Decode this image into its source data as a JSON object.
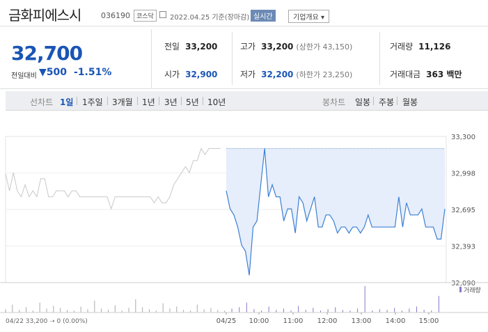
{
  "header": {
    "name": "금화피에스시",
    "code": "036190",
    "market": "코스닥",
    "date": "2022.04.25 기준(장마감)",
    "realtime_label": "실시간",
    "company_label": "기업개요 ▾"
  },
  "summary": {
    "price": "32,700",
    "change_label": "전일대비",
    "change_arrow": "▼",
    "change_value": "500",
    "change_pct": "-1.51%",
    "prev_label": "전일",
    "prev_value": "33,200",
    "open_label": "시가",
    "open_value": "32,900",
    "high_label": "고가",
    "high_value": "33,200",
    "high_sub": "(상한가 43,150)",
    "low_label": "저가",
    "low_value": "32,200",
    "low_sub": "(하한가 23,250)",
    "volume_label": "거래량",
    "volume_value": "11,126",
    "amount_label": "거래대금",
    "amount_value": "363 백만"
  },
  "tabs": {
    "line_label": "선차트",
    "line_tabs": [
      "1일",
      "1주일",
      "3개월",
      "1년",
      "3년",
      "5년",
      "10년"
    ],
    "candle_label": "봉차트",
    "candle_tabs": [
      "일봉",
      "주봉",
      "월봉"
    ]
  },
  "colors": {
    "accent": "#1a55b5",
    "line_today": "#3b7fd4",
    "fill_today": "#e6eefb",
    "line_prev": "#c8c8c8",
    "volume_bar": "#8b76c7"
  },
  "chart_data": {
    "type": "line",
    "y_ticks": [
      "33,300",
      "32,998",
      "32,695",
      "32,393",
      "32,090"
    ],
    "ylim": [
      32090,
      33300
    ],
    "x_ticks": [
      "04/25",
      "10:00",
      "11:00",
      "12:00",
      "13:00",
      "14:00",
      "15:00"
    ],
    "prev_close": 33200,
    "series": [
      {
        "values": [
          32990,
          32850,
          33000,
          32850,
          32800,
          32900,
          32800,
          32850,
          32800,
          32950,
          32950,
          32800,
          32800,
          32850,
          32850,
          32850,
          32800,
          32850,
          32850,
          32800,
          32800,
          32800,
          32800,
          32800,
          32800,
          32800,
          32800,
          32700,
          32800,
          32800,
          32800,
          32800,
          32800,
          32800,
          32800,
          32800,
          32800,
          32800,
          32750,
          32800,
          32750,
          32750,
          32800,
          32900,
          32950,
          33000,
          33050,
          33000,
          33100,
          33100,
          33200,
          33150,
          33200,
          33200,
          33200,
          33200
        ]
      },
      {
        "values": [
          32850,
          32700,
          32650,
          32550,
          32400,
          32350,
          32150,
          32550,
          32600,
          32900,
          33200,
          32800,
          32900,
          32800,
          32800,
          32600,
          32700,
          32700,
          32500,
          32800,
          32750,
          32600,
          32700,
          32800,
          32550,
          32550,
          32650,
          32650,
          32600,
          32500,
          32550,
          32550,
          32500,
          32550,
          32550,
          32500,
          32550,
          32650,
          32550,
          32550,
          32550,
          32550,
          32550,
          32550,
          32550,
          32800,
          32550,
          32750,
          32650,
          32650,
          32650,
          32700,
          32550,
          32550,
          32550,
          32450,
          32450,
          32700
        ]
      }
    ],
    "volume_bar_values": [
      5,
      12,
      4,
      8,
      3,
      15,
      6,
      10,
      7,
      4,
      3,
      9,
      5,
      18,
      6,
      4,
      11,
      3,
      7,
      20,
      8,
      5,
      3,
      14,
      6,
      9,
      4,
      3,
      12,
      5,
      7,
      4,
      3,
      6,
      8,
      15,
      5,
      3,
      9,
      4,
      6,
      3,
      10,
      4,
      7,
      3,
      5,
      8,
      4,
      3,
      6,
      40,
      3,
      5,
      4,
      7,
      3,
      6,
      9,
      4,
      3,
      25
    ],
    "volume_label": "거래량",
    "footer": "04/22  33,200 ➝ 0 (0.00%)"
  }
}
